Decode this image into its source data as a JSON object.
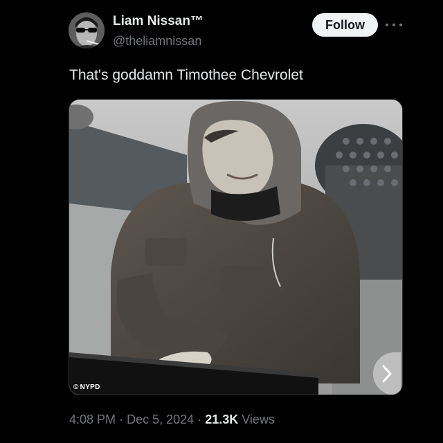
{
  "author": {
    "display_name": "Liam Nissan™",
    "handle": "@theliamnissan",
    "avatar_icon": "avatar-photo"
  },
  "actions": {
    "follow_label": "Follow",
    "more_icon": "ellipsis-icon"
  },
  "tweet": {
    "text": "That's goddamn Timothee Chevrolet"
  },
  "media": {
    "credit": "NYPD",
    "next_icon": "chevron-right-icon"
  },
  "meta": {
    "time": "4:08 PM",
    "separator": "·",
    "date": "Dec 5, 2024",
    "views_count": "21.3K",
    "views_label": "Views"
  },
  "colors": {
    "background": "#000000",
    "primary_text": "#e7e9ea",
    "secondary_text": "#71767b",
    "follow_bg": "#eff3f4",
    "follow_text": "#0f1419"
  }
}
